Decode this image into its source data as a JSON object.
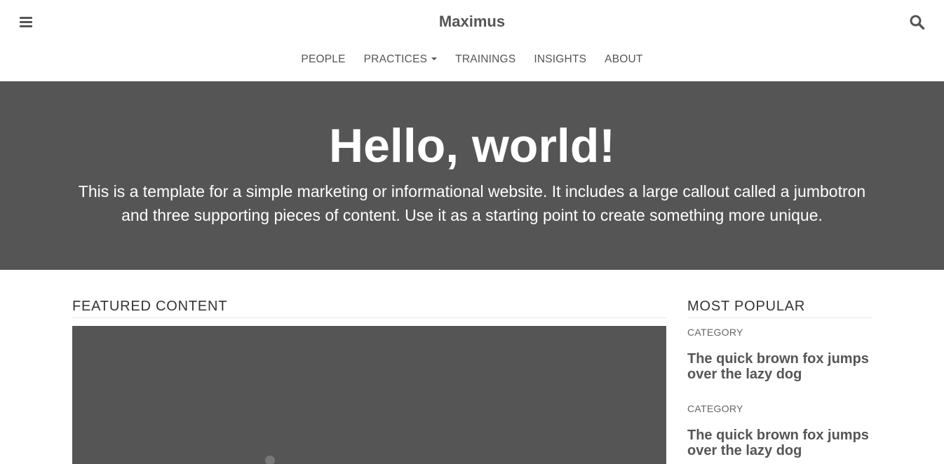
{
  "header": {
    "brand": "Maximus",
    "menu_icon": "hamburger-menu-icon",
    "search_icon": "search-icon"
  },
  "nav": {
    "items": [
      {
        "label": "PEOPLE"
      },
      {
        "label": "PRACTICES",
        "has_dropdown": true
      },
      {
        "label": "TRAININGS"
      },
      {
        "label": "INSIGHTS"
      },
      {
        "label": "ABOUT"
      }
    ]
  },
  "hero": {
    "title": "Hello, world!",
    "text": "This is a template for a simple marketing or informational website. It includes a large callout called a jumbotron and three supporting pieces of content. Use it as a starting point to create something more unique."
  },
  "featured": {
    "title": "FEATURED CONTENT"
  },
  "popular": {
    "title": "MOST POPULAR",
    "items": [
      {
        "category": "CATEGORY",
        "headline": "The quick brown fox jumps over the lazy dog"
      },
      {
        "category": "CATEGORY",
        "headline": "The quick brown fox jumps over the lazy dog"
      }
    ]
  },
  "colors": {
    "hero_bg": "#555555",
    "text": "#555555",
    "white": "#ffffff"
  }
}
